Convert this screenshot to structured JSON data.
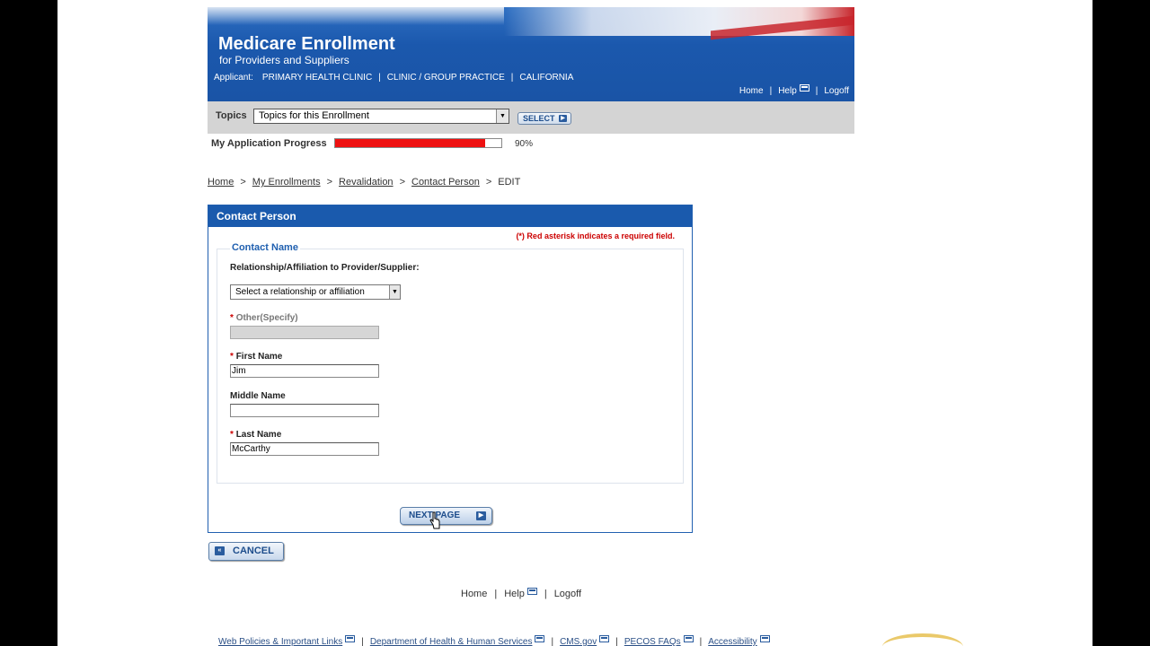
{
  "header": {
    "title": "Medicare Enrollment",
    "subtitle": "for Providers and Suppliers",
    "applicant_label": "Applicant:",
    "applicant_name": "PRIMARY HEALTH CLINIC",
    "applicant_type": "CLINIC / GROUP PRACTICE",
    "applicant_state": "CALIFORNIA",
    "nav": {
      "home": "Home",
      "help": "Help",
      "logoff": "Logoff"
    }
  },
  "topics": {
    "label": "Topics",
    "selected": "Topics for this Enrollment",
    "select_button": "SELECT"
  },
  "progress": {
    "label": "My Application Progress",
    "percent_text": "90%",
    "value": 0.9,
    "bar_color": "#ee1111"
  },
  "breadcrumb": {
    "items": [
      "Home",
      "My Enrollments",
      "Revalidation",
      "Contact Person"
    ],
    "current": "EDIT"
  },
  "panel": {
    "title": "Contact Person",
    "required_note": "(*) Red asterisk indicates a required field.",
    "legend": "Contact Name",
    "relationship_label": "Relationship/Affiliation to Provider/Supplier:",
    "relationship_selected": "Select a relationship or affiliation",
    "other_label": "Other(Specify)",
    "other_value": "",
    "first_name_label": "First Name",
    "first_name_value": "Jim",
    "middle_name_label": "Middle Name",
    "middle_name_value": "",
    "last_name_label": "Last Name",
    "last_name_value": "McCarthy",
    "asterisk": "*",
    "next_button": "NEXT PAGE"
  },
  "cancel_button": "CANCEL",
  "footer_nav": {
    "home": "Home",
    "help": "Help",
    "logoff": "Logoff"
  },
  "footer_links": [
    "Web Policies & Important Links",
    "Department of Health & Human Services",
    "CMS.gov",
    "PECOS FAQs",
    "Accessibility"
  ],
  "icons": {
    "popup": "popup-window-icon",
    "arrow": "arrow-right-icon",
    "back": "double-left-arrow-icon",
    "dropdown": "chevron-down-icon",
    "cursor": "hand-cursor-icon"
  },
  "colors": {
    "brand_blue": "#1a5aad",
    "required_red": "#cc0000",
    "topics_bar": "#d4d4d4"
  }
}
